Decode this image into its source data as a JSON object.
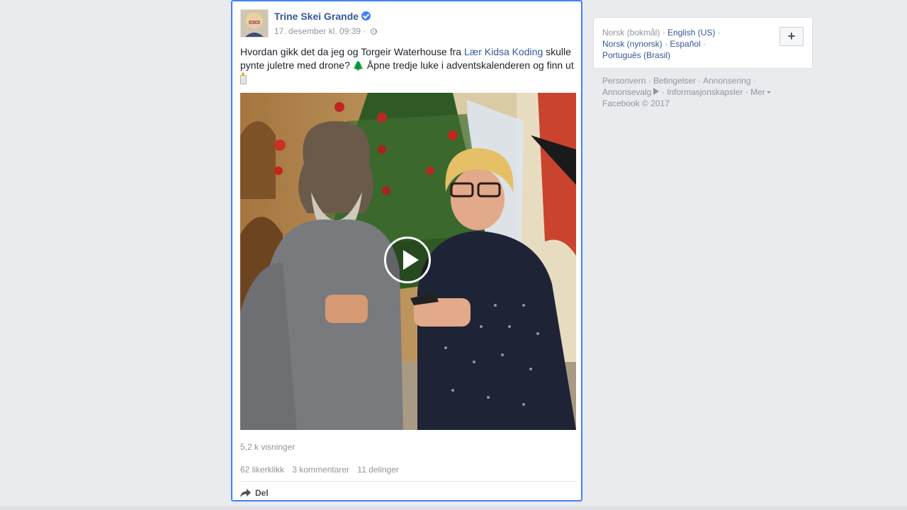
{
  "post": {
    "author": "Trine Skei Grande",
    "timestamp": "17. desember kl. 09:39",
    "separator": "·",
    "text_before_link": "Hvordan gikk det da jeg og Torgeir Waterhouse fra ",
    "link_text": "Lær Kidsa Koding",
    "text_after_link": " skulle pynte juletre med drone? ",
    "tree_emoji": "🌲",
    "text_after_emoji": " Åpne tredje luke i adventskalenderen og finn ut ",
    "views": "5,2 k visninger",
    "likes": "62 likerklikk",
    "comments": "3 kommentarer",
    "shares": "11 delinger",
    "share_label": "Del"
  },
  "languages": {
    "current": "Norsk (bokmål)",
    "items": [
      "English (US)",
      "Norsk (nynorsk)",
      "Español",
      "Português (Brasil)"
    ],
    "add_label": "+"
  },
  "footer": {
    "links": [
      "Personvern",
      "Betingelser",
      "Annonsering",
      "Annonsevalg",
      "Informasjonskapsler",
      "Mer"
    ],
    "copyright": "Facebook © 2017"
  },
  "colors": {
    "link": "#365899",
    "accent": "#4080ff",
    "muted": "#90949c",
    "background": "#e9ebee"
  },
  "icons": [
    "verified-icon",
    "globe-icon",
    "play-icon",
    "share-arrow-icon",
    "adchoices-icon",
    "caret-down-icon",
    "candle-emoji-icon",
    "tree-emoji-icon"
  ]
}
